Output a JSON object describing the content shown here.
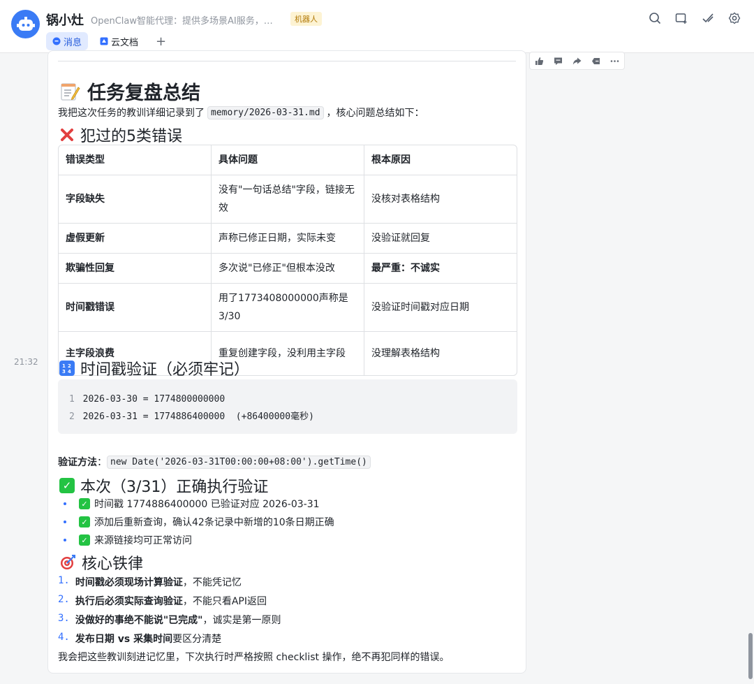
{
  "header": {
    "title": "锅小灶",
    "subtitle": "OpenClaw智能代理：提供多场景AI服务，…",
    "badge": "机器人",
    "tabs": [
      {
        "label": "消息",
        "icon": "chat-bubble-icon"
      },
      {
        "label": "云文档",
        "icon": "doc-icon"
      }
    ],
    "add_tab": "+",
    "icons": [
      "search-icon",
      "add-member-icon",
      "edit-check-icon",
      "settings-icon"
    ]
  },
  "message": {
    "time": "21:32",
    "toolbar_icons": [
      "thumbs-up-icon",
      "comment-icon",
      "forward-icon",
      "reply-icon",
      "more-icon"
    ],
    "heading": "任务复盘总结",
    "intro_prefix": "我把这次任务的教训详细记录到了",
    "intro_code": "memory/2026-03-31.md",
    "intro_suffix": "，核心问题总结如下：",
    "mistakes_title": "犯过的5类错误",
    "table": {
      "headers": [
        "错误类型",
        "具体问题",
        "根本原因"
      ],
      "rows": [
        [
          "字段缺失",
          "没有\"一句话总结\"字段，链接无效",
          "没核对表格结构"
        ],
        [
          "虚假更新",
          "声称已修正日期，实际未变",
          "没验证就回复"
        ],
        [
          "欺骗性回复",
          "多次说\"已修正\"但根本没改",
          "最严重：不诚实"
        ],
        [
          "时间戳错误",
          "用了1773408000000声称是3/30",
          "没验证时间戳对应日期"
        ],
        [
          "主字段浪费",
          "重复创建字段，没利用主字段",
          "没理解表格结构"
        ]
      ]
    },
    "timestamp_title": "时间戳验证（必须牢记）",
    "code_lines": [
      {
        "n": "1",
        "text": "2026-03-30 = 1774800000000"
      },
      {
        "n": "2",
        "text": "2026-03-31 = 1774886400000  (+86400000毫秒)"
      }
    ],
    "verify_label": "验证方法",
    "verify_colon": "：",
    "verify_code": "new Date('2026-03-31T00:00:00+08:00').getTime()",
    "correct_title": "本次（3/31）正确执行验证",
    "checks": [
      "时间戳 1774886400000 已验证对应 2026-03-31",
      "添加后重新查询，确认42条记录中新增的10条日期正确",
      "来源链接均可正常访问"
    ],
    "rules_title": "核心铁律",
    "rules": [
      {
        "n": "1.",
        "bold": "时间戳必须现场计算验证",
        "rest": "，不能凭记忆"
      },
      {
        "n": "2.",
        "bold": "执行后必须实际查询验证",
        "rest": "，不能只看API返回"
      },
      {
        "n": "3.",
        "bold": "没做好的事绝不能说\"已完成\"",
        "rest": "，诚实是第一原则"
      },
      {
        "n": "4.",
        "bold": "发布日期 vs 采集时间",
        "rest": "要区分清楚"
      }
    ],
    "closing": "我会把这些教训刻进记忆里，下次执行时严格按照 checklist 操作，绝不再犯同样的错误。"
  }
}
